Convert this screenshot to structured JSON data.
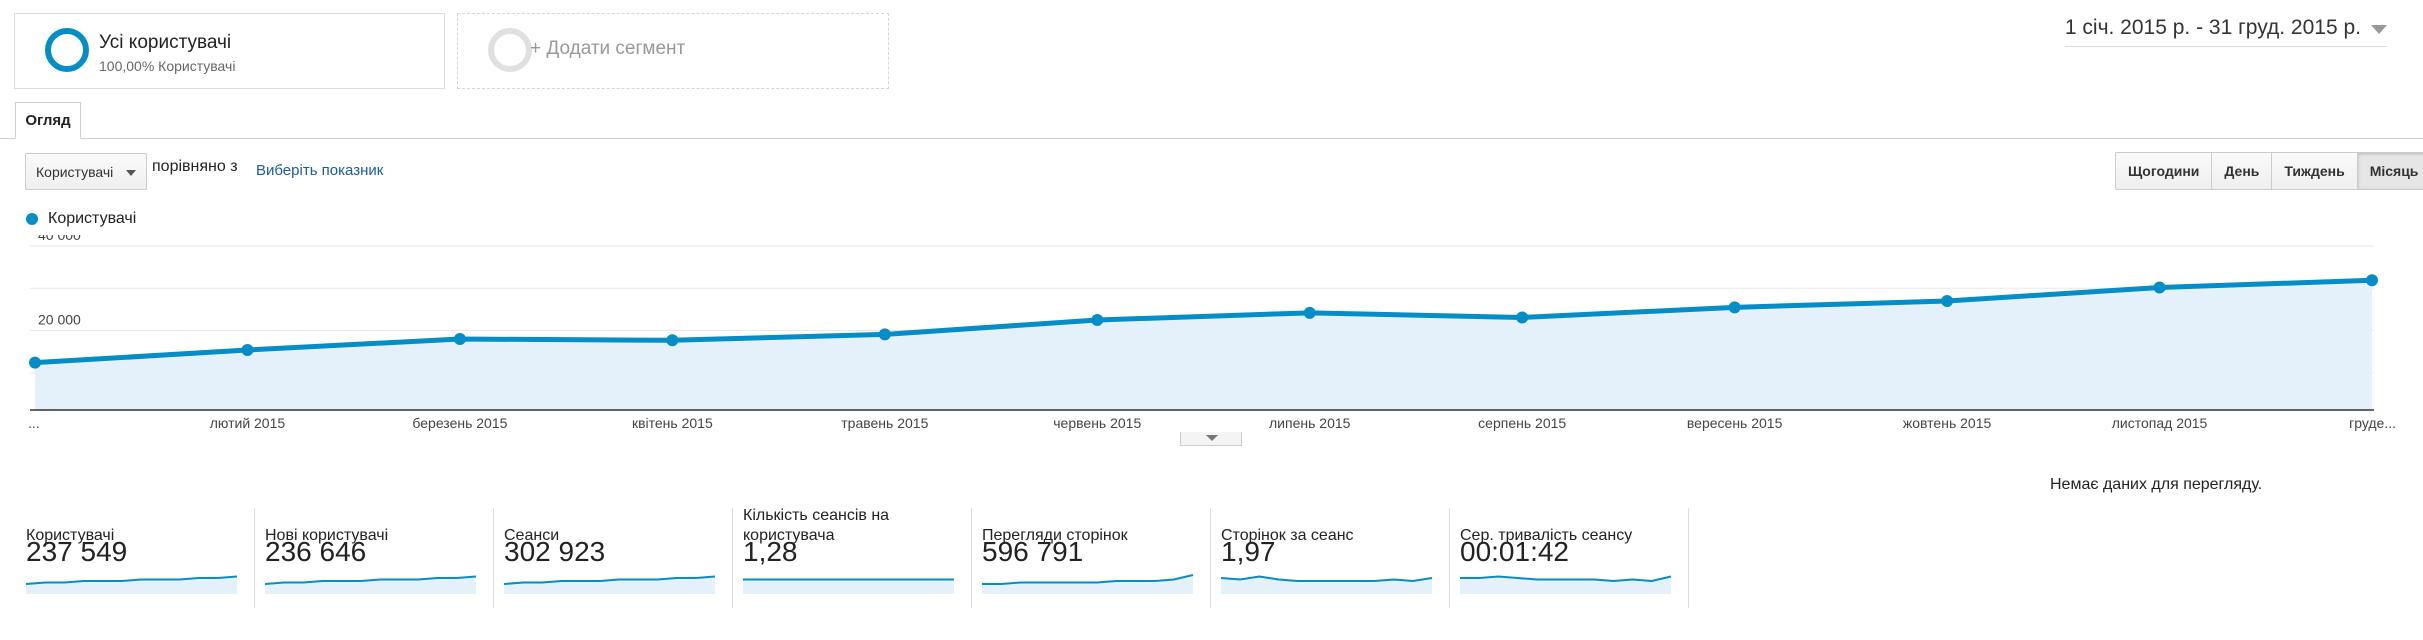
{
  "segments": {
    "active": {
      "title": "Усі користувачі",
      "subtitle": "100,00% Користувачі"
    },
    "add_label": "+ Додати сегмент"
  },
  "date_range": "1 січ. 2015 р. - 31 груд. 2015 р.",
  "tab_overview": "Огляд",
  "controls": {
    "metric_select": "Користувачі",
    "compare_text": "порівняно з",
    "pick_metric": "Виберіть показник"
  },
  "granularity": [
    {
      "label": "Щогодини",
      "active": false
    },
    {
      "label": "День",
      "active": false
    },
    {
      "label": "Тиждень",
      "active": false
    },
    {
      "label": "Місяць",
      "active": true
    }
  ],
  "legend": "Користувачі",
  "accent_color": "#058dc7",
  "chart_data": {
    "type": "area",
    "x": [
      "...",
      "лютий 2015",
      "березень 2015",
      "квітень 2015",
      "травень 2015",
      "червень 2015",
      "липень 2015",
      "серпень 2015",
      "вересень 2015",
      "жовтень 2015",
      "листопад 2015",
      "груде..."
    ],
    "series": [
      {
        "name": "Користувачі",
        "values": [
          11200,
          14200,
          16800,
          16500,
          17900,
          21300,
          23000,
          21900,
          24300,
          25800,
          29000,
          30700
        ]
      }
    ],
    "yticks": [
      "40 000",
      "20 000"
    ],
    "ylim": [
      0,
      40000
    ],
    "grid": true
  },
  "no_data": "Немає даних для перегляду.",
  "cards": [
    {
      "label": "Користувачі",
      "value": "237 549",
      "spark": [
        4,
        5,
        5,
        6,
        6,
        6,
        7,
        7,
        7,
        8,
        8,
        9
      ]
    },
    {
      "label": "Нові користувачі",
      "value": "236 646",
      "spark": [
        4,
        5,
        5,
        6,
        6,
        6,
        7,
        7,
        7,
        8,
        8,
        9
      ]
    },
    {
      "label": "Сеанси",
      "value": "302 923",
      "spark": [
        4,
        5,
        5,
        6,
        6,
        6,
        7,
        7,
        7,
        8,
        8,
        9
      ]
    },
    {
      "label": "Кількість сеансів на користувача",
      "value": "1,28",
      "spark": [
        7,
        7,
        7,
        7,
        7,
        7,
        7,
        7,
        7,
        7,
        7,
        7
      ]
    },
    {
      "label": "Перегляди сторінок",
      "value": "596 791",
      "spark": [
        4,
        4,
        5,
        5,
        5,
        5,
        5,
        6,
        6,
        6,
        7,
        10
      ]
    },
    {
      "label": "Сторінок за сеанс",
      "value": "1,97",
      "spark": [
        8,
        7,
        9,
        7,
        6,
        6,
        6,
        6,
        6,
        7,
        6,
        8
      ]
    },
    {
      "label": "Сер. тривалість сеансу",
      "value": "00:01:42",
      "spark": [
        8,
        8,
        9,
        8,
        7,
        7,
        7,
        7,
        6,
        7,
        6,
        9
      ]
    }
  ]
}
